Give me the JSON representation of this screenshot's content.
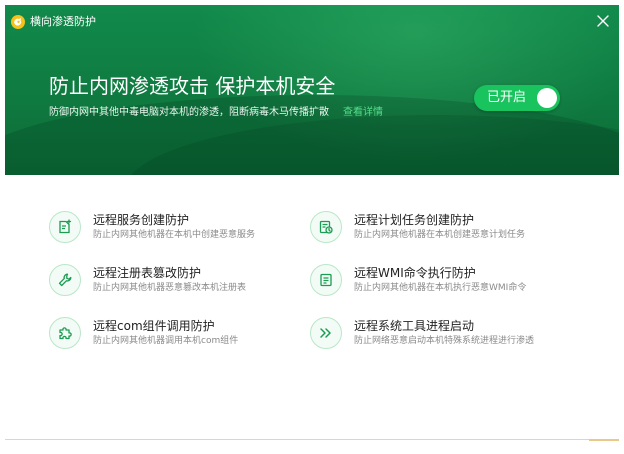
{
  "window": {
    "app_title": "横向渗透防护",
    "icons": {
      "logo": "app-logo-icon",
      "close": "close-icon"
    }
  },
  "banner": {
    "headline": "防止内网渗透攻击 保护本机安全",
    "subtitle": "防御内网中其他中毒电脑对本机的渗透，阻断病毒木马传播扩散",
    "detail_link": "查看详情",
    "toggle_label": "已开启",
    "toggle_on": true,
    "colors": {
      "header": "#0f7a40",
      "toggle": "#19c35e",
      "link": "#54e08a"
    }
  },
  "features": [
    {
      "title": "远程服务创建防护",
      "desc": "防止内网其他机器在本机中创建恶意服务",
      "icon": "service-add-icon"
    },
    {
      "title": "远程计划任务创建防护",
      "desc": "防止内网其他机器在本机创建恶意计划任务",
      "icon": "schedule-task-icon"
    },
    {
      "title": "远程注册表篡改防护",
      "desc": "防止内网其他机器恶意篡改本机注册表",
      "icon": "wrench-icon"
    },
    {
      "title": "远程WMI命令执行防护",
      "desc": "防止内网其他机器在本机执行恶意WMI命令",
      "icon": "document-list-icon"
    },
    {
      "title": "远程com组件调用防护",
      "desc": "防止内网其他机器调用本机com组件",
      "icon": "puzzle-icon"
    },
    {
      "title": "远程系统工具进程启动",
      "desc": "防止网络恶意启动本机特殊系统进程进行渗透",
      "icon": "double-chevron-icon"
    }
  ]
}
